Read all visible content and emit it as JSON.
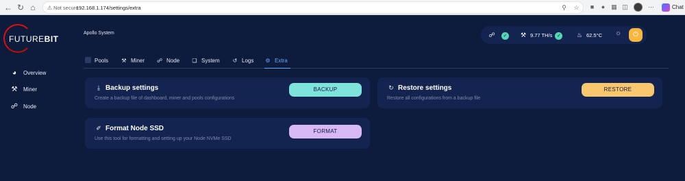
{
  "browser": {
    "url_warning": "Not secure",
    "url": "192.168.1.174/settings/extra",
    "chat_label": "Chat"
  },
  "app": {
    "brand": {
      "part1": "FUTURE",
      "part2": "BIT"
    },
    "system_name": "Apollo System",
    "sidebar": [
      {
        "label": "Overview",
        "icon": "gauge-icon"
      },
      {
        "label": "Miner",
        "icon": "pickaxe-icon"
      },
      {
        "label": "Node",
        "icon": "network-icon"
      }
    ],
    "status": {
      "hashrate": "9.77 TH/s",
      "temperature": "62.5°C"
    },
    "tabs": [
      {
        "label": "Pools",
        "icon": "pools-icon"
      },
      {
        "label": "Miner",
        "icon": "pickaxe-icon"
      },
      {
        "label": "Node",
        "icon": "network-icon"
      },
      {
        "label": "System",
        "icon": "cube-icon"
      },
      {
        "label": "Logs",
        "icon": "history-icon"
      },
      {
        "label": "Extra",
        "icon": "gear-icon",
        "active": true
      }
    ],
    "cards": {
      "backup": {
        "title": "Backup settings",
        "description": "Create a backup file of dashboard, miner and pools configurations",
        "button": "BACKUP"
      },
      "restore": {
        "title": "Restore settings",
        "description": "Restore all configurations from a backup file",
        "button": "RESTORE"
      },
      "format": {
        "title": "Format Node SSD",
        "description": "Use this tool for formatting and setting up your Node NVMe SSD",
        "button": "FORMAT"
      }
    }
  },
  "colors": {
    "background": "#0d1b3d",
    "card": "#132450",
    "backup_button": "#7ee3da",
    "format_button": "#d7b8f5",
    "restore_button": "#f8c76e",
    "active_tab": "#66a8ff",
    "status_ok": "#56d7b1",
    "power": "#f7b83c"
  }
}
